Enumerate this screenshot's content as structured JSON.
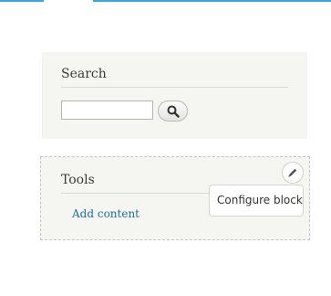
{
  "search_block": {
    "title": "Search",
    "input_value": "",
    "submit_icon": "search-icon"
  },
  "tools_block": {
    "title": "Tools",
    "links": [
      {
        "label": "Add content"
      }
    ]
  },
  "contextual": {
    "trigger_icon": "pencil-icon",
    "menu_items": [
      {
        "label": "Configure block"
      }
    ]
  },
  "colors": {
    "accent": "#3aa8e0",
    "link": "#1a6fa6",
    "block_background": "#f5f5f2"
  }
}
